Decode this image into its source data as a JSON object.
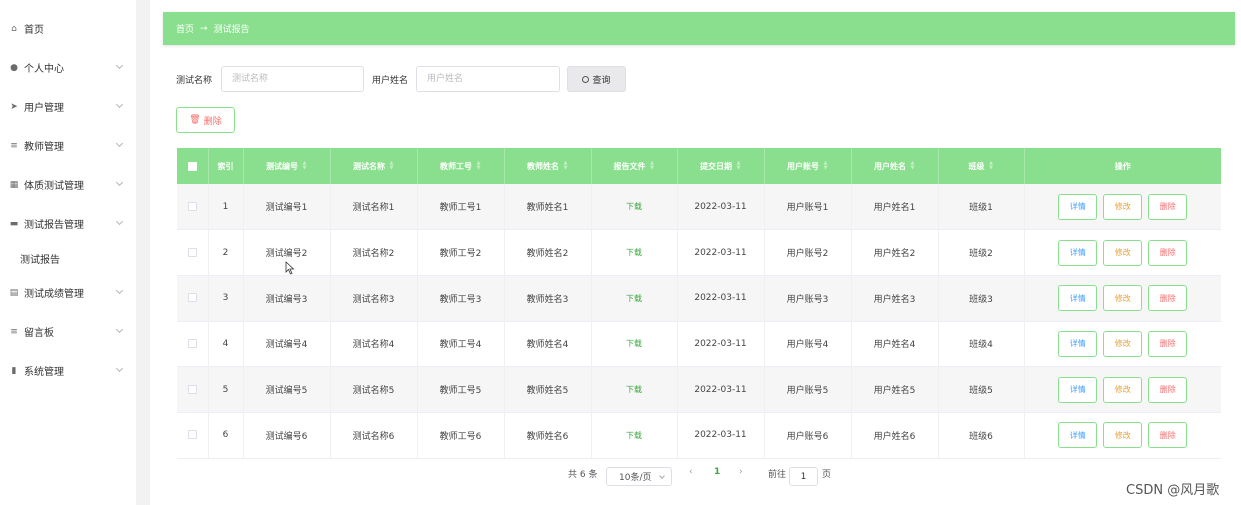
{
  "sidebar": {
    "items": [
      {
        "label": "首页",
        "icon": "home-icon"
      },
      {
        "label": "个人中心",
        "icon": "user-icon"
      },
      {
        "label": "用户管理",
        "icon": "send-icon"
      },
      {
        "label": "教师管理",
        "icon": "list-icon"
      },
      {
        "label": "体质测试管理",
        "icon": "grid-icon"
      },
      {
        "label": "测试报告管理",
        "icon": "menu-icon"
      },
      {
        "label": "测试成绩管理",
        "icon": "book-icon"
      },
      {
        "label": "留言板",
        "icon": "list-icon"
      },
      {
        "label": "系统管理",
        "icon": "chart-icon"
      }
    ],
    "sub_item": "测试报告"
  },
  "breadcrumb": {
    "home": "首页",
    "separator": "→",
    "current": "测试报告"
  },
  "search": {
    "name_label": "测试名称",
    "name_placeholder": "测试名称",
    "user_label": "用户姓名",
    "user_placeholder": "用户姓名",
    "query_label": "查询"
  },
  "delete_label": "删除",
  "table": {
    "headers": {
      "index": "索引",
      "test_no": "测试编号",
      "test_name": "测试名称",
      "teacher_no": "教师工号",
      "teacher_name": "教师姓名",
      "report": "报告文件",
      "submit_date": "提交日期",
      "user_account": "用户账号",
      "user_name": "用户姓名",
      "class": "班级",
      "actions": "操作"
    },
    "rows": [
      {
        "index": "1",
        "test_no": "测试编号1",
        "test_name": "测试名称1",
        "teacher_no": "教师工号1",
        "teacher_name": "教师姓名1",
        "report": "下载",
        "submit_date": "2022-03-11",
        "user_account": "用户账号1",
        "user_name": "用户姓名1",
        "class": "班级1"
      },
      {
        "index": "2",
        "test_no": "测试编号2",
        "test_name": "测试名称2",
        "teacher_no": "教师工号2",
        "teacher_name": "教师姓名2",
        "report": "下载",
        "submit_date": "2022-03-11",
        "user_account": "用户账号2",
        "user_name": "用户姓名2",
        "class": "班级2"
      },
      {
        "index": "3",
        "test_no": "测试编号3",
        "test_name": "测试名称3",
        "teacher_no": "教师工号3",
        "teacher_name": "教师姓名3",
        "report": "下载",
        "submit_date": "2022-03-11",
        "user_account": "用户账号3",
        "user_name": "用户姓名3",
        "class": "班级3"
      },
      {
        "index": "4",
        "test_no": "测试编号4",
        "test_name": "测试名称4",
        "teacher_no": "教师工号4",
        "teacher_name": "教师姓名4",
        "report": "下载",
        "submit_date": "2022-03-11",
        "user_account": "用户账号4",
        "user_name": "用户姓名4",
        "class": "班级4"
      },
      {
        "index": "5",
        "test_no": "测试编号5",
        "test_name": "测试名称5",
        "teacher_no": "教师工号5",
        "teacher_name": "教师姓名5",
        "report": "下载",
        "submit_date": "2022-03-11",
        "user_account": "用户账号5",
        "user_name": "用户姓名5",
        "class": "班级5"
      },
      {
        "index": "6",
        "test_no": "测试编号6",
        "test_name": "测试名称6",
        "teacher_no": "教师工号6",
        "teacher_name": "教师姓名6",
        "report": "下载",
        "submit_date": "2022-03-11",
        "user_account": "用户账号6",
        "user_name": "用户姓名6",
        "class": "班级6"
      }
    ],
    "actions": {
      "detail": "详情",
      "edit": "修改",
      "delete": "删除"
    }
  },
  "pagination": {
    "total": "共 6 条",
    "page_size": "10条/页",
    "prev": "‹",
    "current_page": "1",
    "next": "›",
    "goto_label": "前往",
    "goto_value": "1",
    "page_unit": "页"
  },
  "watermark": "CSDN @风月歌",
  "colors": {
    "accent": "#89df8d",
    "danger": "#f56c6c",
    "primary": "#409eff",
    "warning": "#e6a23c"
  }
}
